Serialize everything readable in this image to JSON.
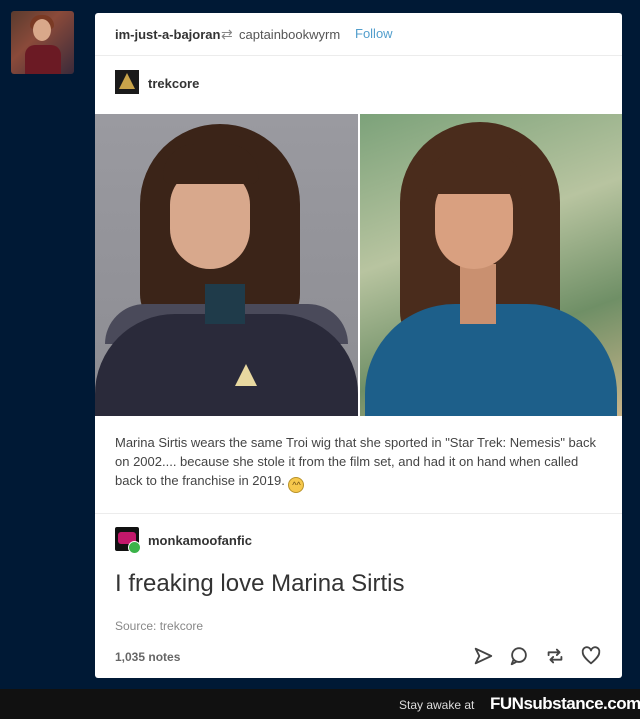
{
  "reblogger": {
    "username": "im-just-a-bajoran",
    "reblogged_from": "captainbookwyrm",
    "follow_label": "Follow"
  },
  "source_post": {
    "username": "trekcore",
    "caption": "Marina Sirtis wears the same Troi wig that she sported in \"Star Trek: Nemesis\" back on 2002.... because she stole it from the film set, and had it on hand when called back to the franchise in 2019."
  },
  "reply": {
    "username": "monkamoofanfic",
    "text": "I freaking love Marina Sirtis"
  },
  "meta": {
    "source_label": "Source: trekcore",
    "notes": "1,035 notes"
  },
  "footer": {
    "tagline": "Stay awake at",
    "brand": "FUNsubstance.com"
  },
  "icons": [
    "reblog-icon",
    "share-icon",
    "reply-icon",
    "reblog-action-icon",
    "like-icon"
  ],
  "colors": {
    "background": "#001935",
    "follow": "#529ecc"
  }
}
